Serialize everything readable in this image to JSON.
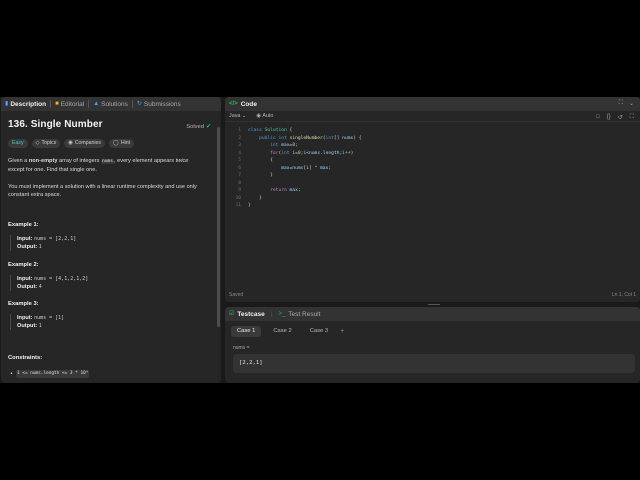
{
  "left_tabs": [
    {
      "label": "Description",
      "active": true
    },
    {
      "label": "Editorial",
      "active": false
    },
    {
      "label": "Solutions",
      "active": false
    },
    {
      "label": "Submissions",
      "active": false
    }
  ],
  "problem": {
    "title": "136. Single Number",
    "status": "Solved",
    "difficulty": "Easy",
    "chips": [
      "Topics",
      "Companies",
      "Hint"
    ],
    "desc1_a": "Given a ",
    "desc1_b": "non-empty",
    "desc1_c": " array of integers ",
    "desc1_code": "nums",
    "desc1_d": ", every element appears ",
    "desc1_e": "twice",
    "desc1_f": " except for one. Find that single one.",
    "desc2": "You must implement a solution with a linear runtime complexity and use only constant extra space.",
    "examples": [
      {
        "heading": "Example 1:",
        "input_label": "Input:",
        "input": "nums = [2,2,1]",
        "output_label": "Output:",
        "output": "1"
      },
      {
        "heading": "Example 2:",
        "input_label": "Input:",
        "input": "nums = [4,1,2,1,2]",
        "output_label": "Output:",
        "output": "4"
      },
      {
        "heading": "Example 3:",
        "input_label": "Input:",
        "input": "nums = [1]",
        "output_label": "Output:",
        "output": "1"
      }
    ],
    "constraints_heading": "Constraints:",
    "constraint1": "1 <= nums.length <= 3 * 10⁴"
  },
  "code_panel": {
    "title": "Code",
    "language": "Java",
    "mode": "Auto",
    "line_numbers": [
      "1",
      "2",
      "3",
      "4",
      "5",
      "6",
      "7",
      "8",
      "9",
      "10",
      "11"
    ],
    "saved": "Saved",
    "cursor": "Ln 1, Col 1"
  },
  "test_panel": {
    "tab_testcase": "Testcase",
    "tab_result": "Test Result",
    "cases": [
      "Case 1",
      "Case 2",
      "Case 3"
    ],
    "label": "nums =",
    "value": "[2,2,1]"
  }
}
